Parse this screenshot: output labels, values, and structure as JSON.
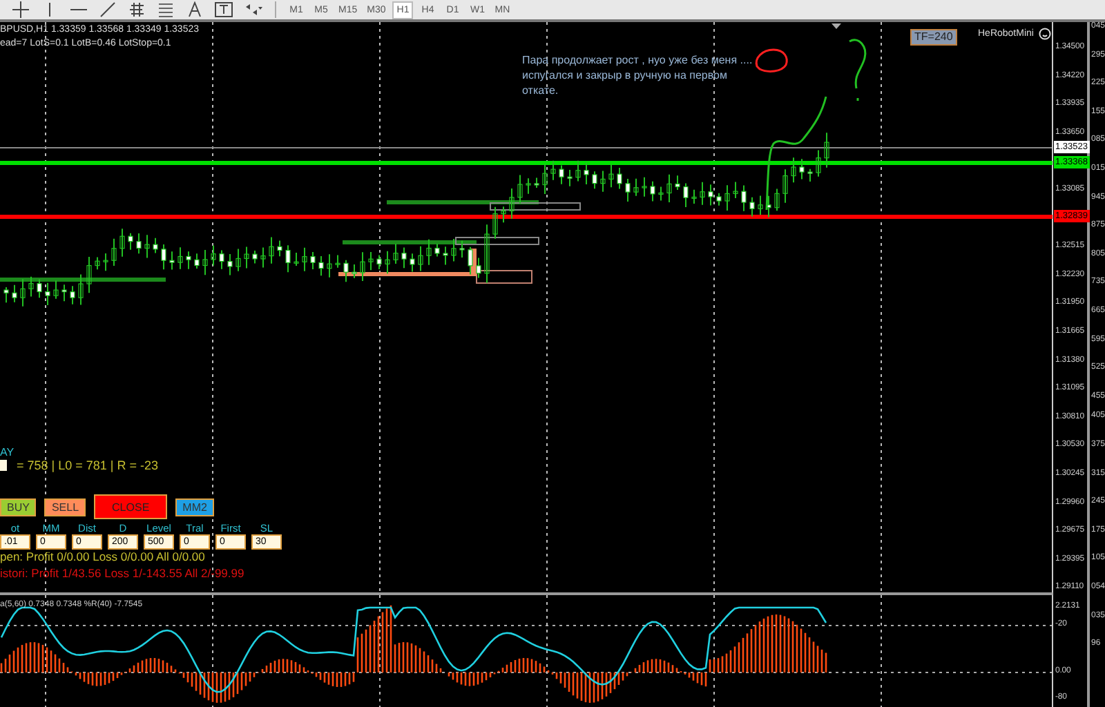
{
  "toolbar": {
    "tools": [
      {
        "kind": "crosshair"
      },
      {
        "kind": "vline"
      },
      {
        "kind": "hline"
      },
      {
        "kind": "trend"
      },
      {
        "kind": "fibo"
      },
      {
        "kind": "channel"
      },
      {
        "kind": "text"
      },
      {
        "kind": "label"
      },
      {
        "kind": "arrows"
      }
    ],
    "timeframes": [
      {
        "label": "M1",
        "selected": false
      },
      {
        "label": "M5",
        "selected": false
      },
      {
        "label": "M15",
        "selected": false
      },
      {
        "label": "M30",
        "selected": false
      },
      {
        "label": "H1",
        "selected": true
      },
      {
        "label": "H4",
        "selected": false
      },
      {
        "label": "D1",
        "selected": false
      },
      {
        "label": "W1",
        "selected": false
      },
      {
        "label": "MN",
        "selected": false
      }
    ]
  },
  "chart": {
    "symbol_line": "BPUSD,H1  1.33359 1.33568 1.33349 1.33523",
    "params_line": "ead=7  LotS=0.1  LotB=0.46  LotStop=0.1",
    "note": "Пара продолжает рост , нуо уже без меня .... испугался и закрыр в ручную на первом откате.",
    "tf_badge": "TF=240",
    "robot_label": "HeRobotMini",
    "price_axis": [
      "1.34500",
      "1.34220",
      "1.33935",
      "1.33650",
      "1.33085",
      "1.32515",
      "1.32230",
      "1.31950",
      "1.31665",
      "1.31380",
      "1.31095",
      "1.30810",
      "1.30530",
      "1.30245",
      "1.29960",
      "1.29675",
      "1.29395",
      "1.29110"
    ],
    "price_tags": [
      {
        "text": "1.33523",
        "color": "#ffffff"
      },
      {
        "text": "1.33368",
        "color": "#00e000"
      },
      {
        "text": "1.32839",
        "color": "#ff0000"
      }
    ]
  },
  "panel": {
    "title": "AY",
    "stats": "= 758 | L0 = 781 | R = -23",
    "buttons": [
      {
        "label": "BUY",
        "color": "#9acd32"
      },
      {
        "label": "SELL",
        "color": "#ff8c5a"
      },
      {
        "label": "CLOSE",
        "color": "#ff0000"
      },
      {
        "label": "MM2",
        "color": "#1ea0e6"
      }
    ],
    "fields": [
      {
        "label": "ot",
        "value": ".01"
      },
      {
        "label": "MM",
        "value": "0"
      },
      {
        "label": "Dist",
        "value": "0"
      },
      {
        "label": "D",
        "value": "200"
      },
      {
        "label": "Level",
        "value": "500"
      },
      {
        "label": "Tral",
        "value": "0"
      },
      {
        "label": "First",
        "value": "0"
      },
      {
        "label": "SL",
        "value": "30"
      }
    ],
    "open_line": "pen:  Profit 0/0.00  Loss 0/0.00  All 0/0.00",
    "history_line": "istori: Profit 1/43.56  Loss 1/-143.55  All 2/-99.99"
  },
  "indicator": {
    "label": "a(5,60) 0.7348 0.7348  %R(40) -7.7545",
    "axis": [
      "2.2131",
      "-20",
      "0.00",
      "-80"
    ]
  },
  "right_strip": [
    "045",
    "295",
    "225",
    "155",
    "085",
    "015",
    "945",
    "875",
    "805",
    "735",
    "665",
    "595",
    "525",
    "455",
    "405",
    "375",
    "315",
    "245",
    "175",
    "105",
    "054",
    "035",
    "96"
  ]
}
